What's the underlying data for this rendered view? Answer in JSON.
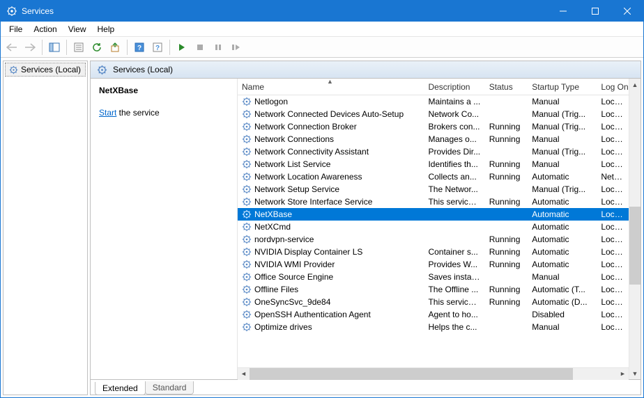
{
  "window": {
    "title": "Services"
  },
  "menu": {
    "file": "File",
    "action": "Action",
    "view": "View",
    "help": "Help"
  },
  "tree": {
    "root": "Services (Local)"
  },
  "detail_header": "Services (Local)",
  "info": {
    "selected_name": "NetXBase",
    "start_link": "Start",
    "start_suffix": " the service"
  },
  "columns": {
    "name": "Name",
    "desc": "Description",
    "status": "Status",
    "start": "Startup Type",
    "log": "Log On"
  },
  "columns_trunc": {
    "log": "Log On"
  },
  "rows": [
    {
      "name": "Netlogon",
      "desc": "Maintains a ...",
      "status": "",
      "start": "Manual",
      "log": "Local S"
    },
    {
      "name": "Network Connected Devices Auto-Setup",
      "desc": "Network Co...",
      "status": "",
      "start": "Manual (Trig...",
      "log": "Local S"
    },
    {
      "name": "Network Connection Broker",
      "desc": "Brokers con...",
      "status": "Running",
      "start": "Manual (Trig...",
      "log": "Local S"
    },
    {
      "name": "Network Connections",
      "desc": "Manages o...",
      "status": "Running",
      "start": "Manual",
      "log": "Local S"
    },
    {
      "name": "Network Connectivity Assistant",
      "desc": "Provides Dir...",
      "status": "",
      "start": "Manual (Trig...",
      "log": "Local S"
    },
    {
      "name": "Network List Service",
      "desc": "Identifies th...",
      "status": "Running",
      "start": "Manual",
      "log": "Local S"
    },
    {
      "name": "Network Location Awareness",
      "desc": "Collects an...",
      "status": "Running",
      "start": "Automatic",
      "log": "Netwo"
    },
    {
      "name": "Network Setup Service",
      "desc": "The Networ...",
      "status": "",
      "start": "Manual (Trig...",
      "log": "Local S"
    },
    {
      "name": "Network Store Interface Service",
      "desc": "This service ...",
      "status": "Running",
      "start": "Automatic",
      "log": "Local S"
    },
    {
      "name": "NetXBase",
      "desc": "",
      "status": "",
      "start": "Automatic",
      "log": "Local S",
      "sel": true
    },
    {
      "name": "NetXCmd",
      "desc": "",
      "status": "",
      "start": "Automatic",
      "log": "Local S"
    },
    {
      "name": "nordvpn-service",
      "desc": "",
      "status": "Running",
      "start": "Automatic",
      "log": "Local S"
    },
    {
      "name": "NVIDIA Display Container LS",
      "desc": "Container s...",
      "status": "Running",
      "start": "Automatic",
      "log": "Local S"
    },
    {
      "name": "NVIDIA WMI Provider",
      "desc": "Provides W...",
      "status": "Running",
      "start": "Automatic",
      "log": "Local S"
    },
    {
      "name": "Office Source Engine",
      "desc": "Saves install...",
      "status": "",
      "start": "Manual",
      "log": "Local S"
    },
    {
      "name": "Offline Files",
      "desc": "The Offline ...",
      "status": "Running",
      "start": "Automatic (T...",
      "log": "Local S"
    },
    {
      "name": "OneSyncSvc_9de84",
      "desc": "This service ...",
      "status": "Running",
      "start": "Automatic (D...",
      "log": "Local S"
    },
    {
      "name": "OpenSSH Authentication Agent",
      "desc": "Agent to ho...",
      "status": "",
      "start": "Disabled",
      "log": "Local S"
    },
    {
      "name": "Optimize drives",
      "desc": "Helps the c...",
      "status": "",
      "start": "Manual",
      "log": "Local S"
    }
  ],
  "tabs": {
    "extended": "Extended",
    "standard": "Standard"
  }
}
